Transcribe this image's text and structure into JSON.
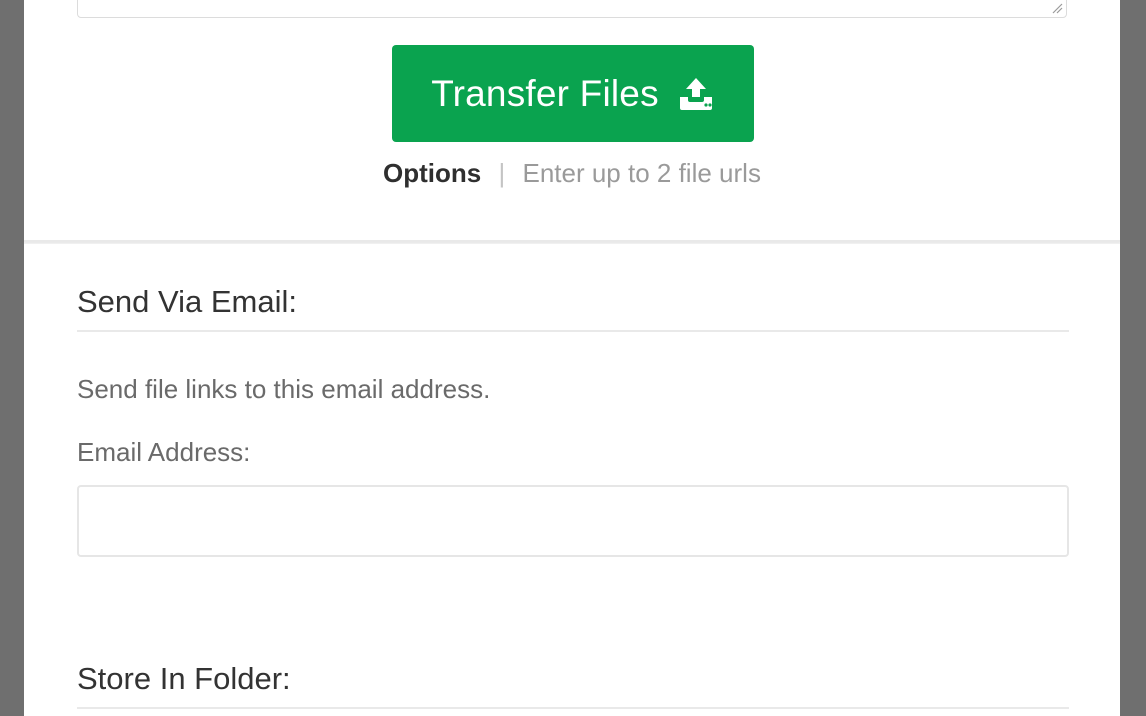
{
  "upload": {
    "url_textarea_value": "",
    "transfer_button_label": "Transfer Files",
    "transfer_button_icon": "upload-icon",
    "options_label": "Options",
    "separator": "|",
    "hint_text": "Enter up to 2 file urls"
  },
  "email_section": {
    "heading": "Send Via Email:",
    "description": "Send file links to this email address.",
    "field_label": "Email Address:",
    "field_value": ""
  },
  "folder_section": {
    "heading": "Store In Folder:"
  },
  "colors": {
    "accent_green": "#0aa34f",
    "backdrop": "#6f6f6f"
  }
}
